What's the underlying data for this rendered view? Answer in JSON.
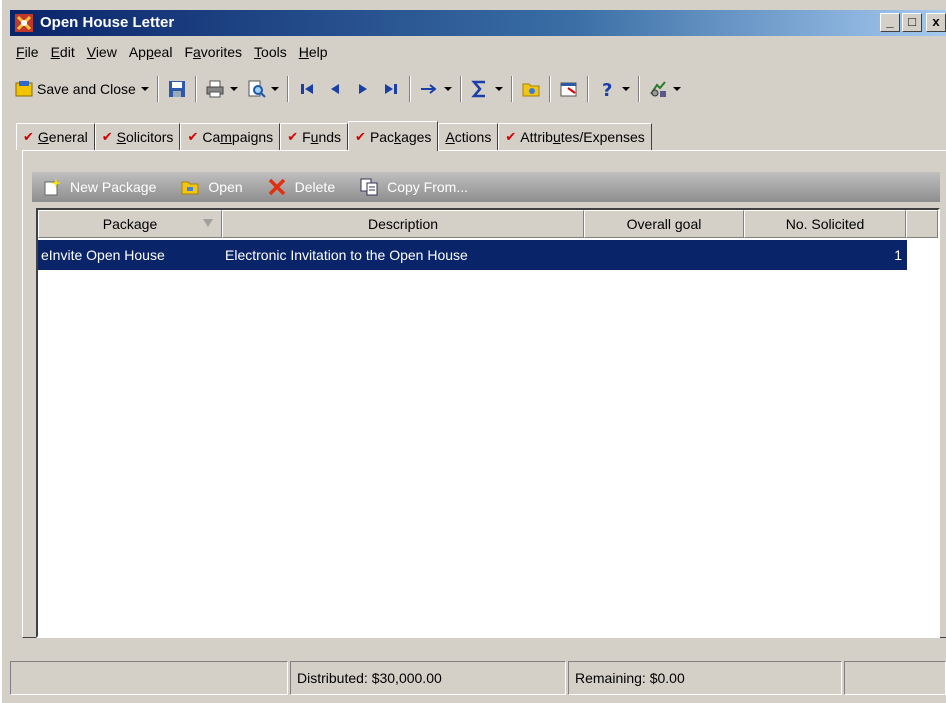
{
  "window": {
    "title": "Open House Letter"
  },
  "title_buttons": {
    "minimize": "_",
    "maximize": "□",
    "close": "x"
  },
  "menu": [
    {
      "label": "File",
      "u": "F",
      "rest": "ile"
    },
    {
      "label": "Edit",
      "u": "E",
      "rest": "dit"
    },
    {
      "label": "View",
      "u": "V",
      "rest": "iew"
    },
    {
      "label": "Appeal",
      "pre": "Ap",
      "u": "p",
      "rest": "eal"
    },
    {
      "label": "Favorites",
      "pre": "F",
      "u": "a",
      "rest": "vorites"
    },
    {
      "label": "Tools",
      "u": "T",
      "rest": "ools"
    },
    {
      "label": "Help",
      "u": "H",
      "rest": "elp"
    }
  ],
  "toolbar": {
    "save_close": "Save and Close"
  },
  "tabs": [
    {
      "pre": "",
      "u": "G",
      "rest": "eneral",
      "checked": true
    },
    {
      "pre": "",
      "u": "S",
      "rest": "olicitors",
      "checked": true
    },
    {
      "pre": "Ca",
      "u": "m",
      "rest": "paigns",
      "checked": true
    },
    {
      "pre": "F",
      "u": "u",
      "rest": "nds",
      "checked": true
    },
    {
      "pre": "Pac",
      "u": "k",
      "rest": "ages",
      "checked": true,
      "active": true
    },
    {
      "pre": "",
      "u": "A",
      "rest": "ctions",
      "checked": false
    },
    {
      "pre": "Attrib",
      "u": "u",
      "rest": "tes/Expenses",
      "checked": true
    }
  ],
  "subtoolbar": {
    "new_package": "New Package",
    "open": "Open",
    "delete": "Delete",
    "copy_from": "Copy From..."
  },
  "grid": {
    "columns": [
      "Package",
      "Description",
      "Overall goal",
      "No. Solicited"
    ],
    "rows": [
      {
        "package": "eInvite Open House",
        "description": "Electronic Invitation to the Open House",
        "overall_goal": "",
        "no_solicited": "1"
      }
    ]
  },
  "status": {
    "distributed": "Distributed: $30,000.00",
    "remaining": "Remaining: $0.00"
  },
  "colors": {
    "selection": "#0a246a",
    "check": "#d40000",
    "title_start": "#0a246a"
  }
}
